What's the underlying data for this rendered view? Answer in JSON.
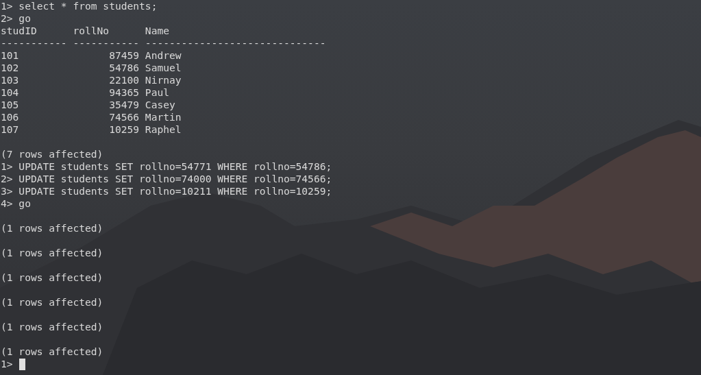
{
  "terminal": {
    "lines": [
      {
        "kind": "text",
        "text": "1> select * from students;"
      },
      {
        "kind": "text",
        "text": "2> go"
      },
      {
        "kind": "text",
        "text": "studID      rollNo      Name"
      },
      {
        "kind": "text",
        "text": "----------- ----------- ------------------------------"
      },
      {
        "kind": "text",
        "text": "101               87459 Andrew"
      },
      {
        "kind": "text",
        "text": "102               54786 Samuel"
      },
      {
        "kind": "text",
        "text": "103               22100 Nirnay"
      },
      {
        "kind": "text",
        "text": "104               94365 Paul"
      },
      {
        "kind": "text",
        "text": "105               35479 Casey"
      },
      {
        "kind": "text",
        "text": "106               74566 Martin"
      },
      {
        "kind": "text",
        "text": "107               10259 Raphel"
      },
      {
        "kind": "blank"
      },
      {
        "kind": "text",
        "text": "(7 rows affected)"
      },
      {
        "kind": "text",
        "text": "1> UPDATE students SET rollno=54771 WHERE rollno=54786;"
      },
      {
        "kind": "text",
        "text": "2> UPDATE students SET rollno=74000 WHERE rollno=74566;"
      },
      {
        "kind": "text",
        "text": "3> UPDATE students SET rollno=10211 WHERE rollno=10259;"
      },
      {
        "kind": "text",
        "text": "4> go"
      },
      {
        "kind": "blank"
      },
      {
        "kind": "text",
        "text": "(1 rows affected)"
      },
      {
        "kind": "blank"
      },
      {
        "kind": "text",
        "text": "(1 rows affected)"
      },
      {
        "kind": "blank"
      },
      {
        "kind": "text",
        "text": "(1 rows affected)"
      },
      {
        "kind": "blank"
      },
      {
        "kind": "text",
        "text": "(1 rows affected)"
      },
      {
        "kind": "blank"
      },
      {
        "kind": "text",
        "text": "(1 rows affected)"
      },
      {
        "kind": "blank"
      },
      {
        "kind": "text",
        "text": "(1 rows affected)"
      },
      {
        "kind": "prompt",
        "text": "1>"
      }
    ]
  }
}
